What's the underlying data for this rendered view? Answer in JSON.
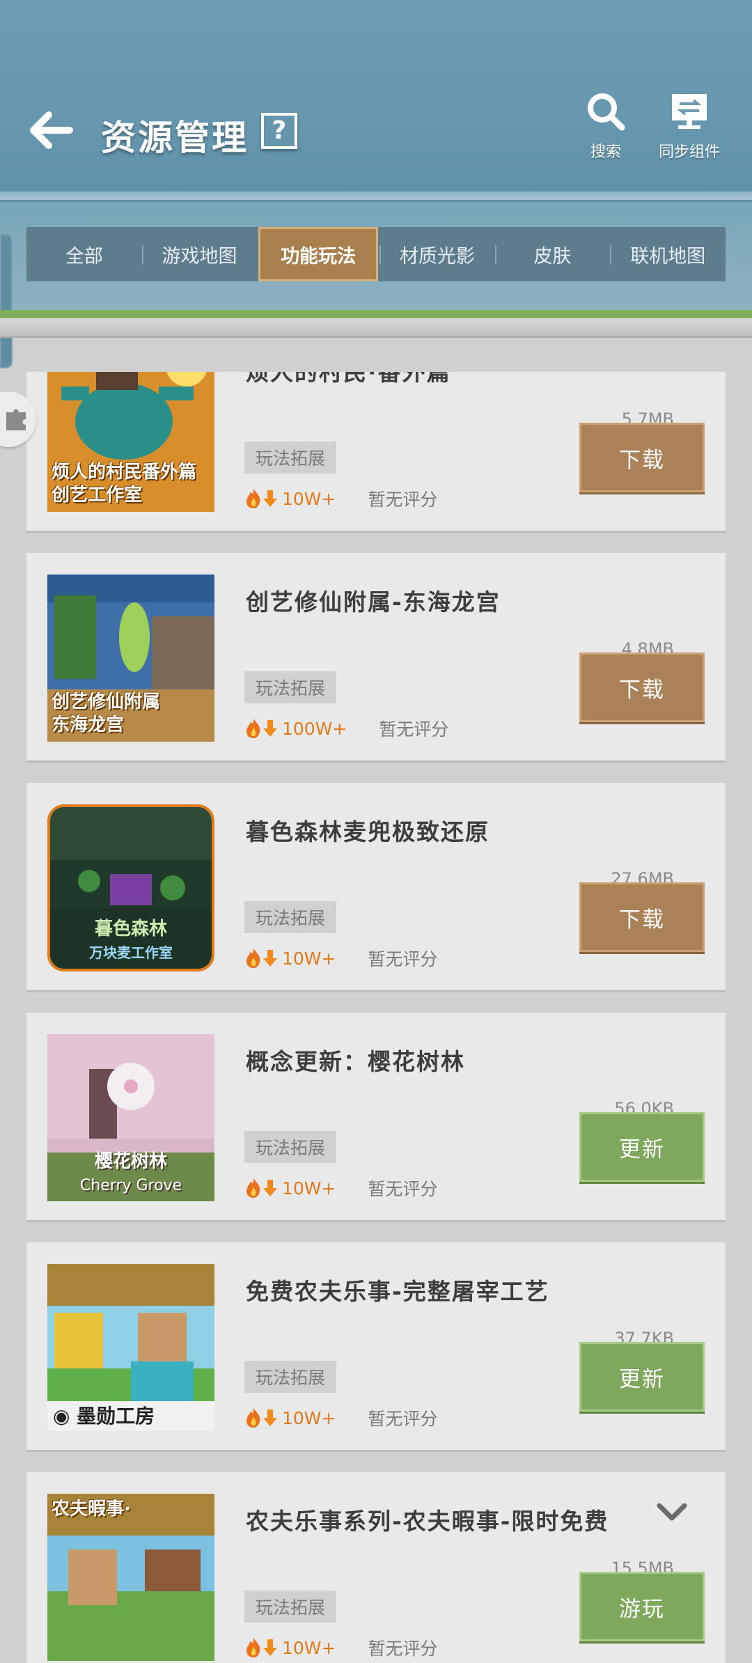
{
  "header": {
    "title": "资源管理",
    "help_label": "?",
    "search_label": "搜索",
    "sync_label": "同步组件"
  },
  "tabs": [
    {
      "label": "全部"
    },
    {
      "label": "游戏地图"
    },
    {
      "label": "功能玩法",
      "active": true
    },
    {
      "label": "材质光影"
    },
    {
      "label": "皮肤"
    },
    {
      "label": "联机地图"
    }
  ],
  "items": [
    {
      "name": "烦人的村民·番外篇",
      "size": "5.7MB",
      "tag": "玩法拓展",
      "downloads": "10W+",
      "rating": "暂无评分",
      "action": "下载",
      "thumb_caption": "烦人的村民番外篇\n创艺工作室"
    },
    {
      "name": "创艺修仙附属-东海龙宫",
      "size": "4.8MB",
      "tag": "玩法拓展",
      "downloads": "100W+",
      "rating": "暂无评分",
      "action": "下载",
      "thumb_caption": "创艺修仙附属\n东海龙宫"
    },
    {
      "name": "暮色森林麦兜极致还原",
      "size": "27.6MB",
      "tag": "玩法拓展",
      "downloads": "10W+",
      "rating": "暂无评分",
      "action": "下载",
      "thumb_caption": "暮色森林\n万块麦工作室"
    },
    {
      "name": "概念更新：樱花树林",
      "size": "56.0KB",
      "tag": "玩法拓展",
      "downloads": "10W+",
      "rating": "暂无评分",
      "action": "更新",
      "thumb_caption": "樱花树林\nCherry Grove"
    },
    {
      "name": "免费农夫乐事-完整屠宰工艺",
      "size": "37.7KB",
      "tag": "玩法拓展",
      "downloads": "10W+",
      "rating": "暂无评分",
      "action": "更新",
      "thumb_caption": "墨勋工房"
    },
    {
      "name": "农夫乐事系列-农夫暇事-限时免费",
      "size": "15.5MB",
      "tag": "玩法拓展",
      "downloads": "10W+",
      "rating": "暂无评分",
      "action": "游玩",
      "thumb_caption": "农夫暇事·"
    }
  ],
  "colors": {
    "header_bg": "#6d9cb3",
    "tab_active": "#a87f4d",
    "download_btn": "#ab8158",
    "update_btn": "#7ea85c",
    "accent_green": "#7fb05d",
    "downloads_text": "#e07a1a"
  },
  "icons": {
    "back": "arrow-left-icon",
    "help": "question-icon",
    "search": "search-icon",
    "sync": "sync-monitor-icon",
    "fire": "fire-icon",
    "download_arrow": "arrow-down-icon",
    "expand": "chevron-down-icon",
    "puzzle": "puzzle-icon"
  }
}
